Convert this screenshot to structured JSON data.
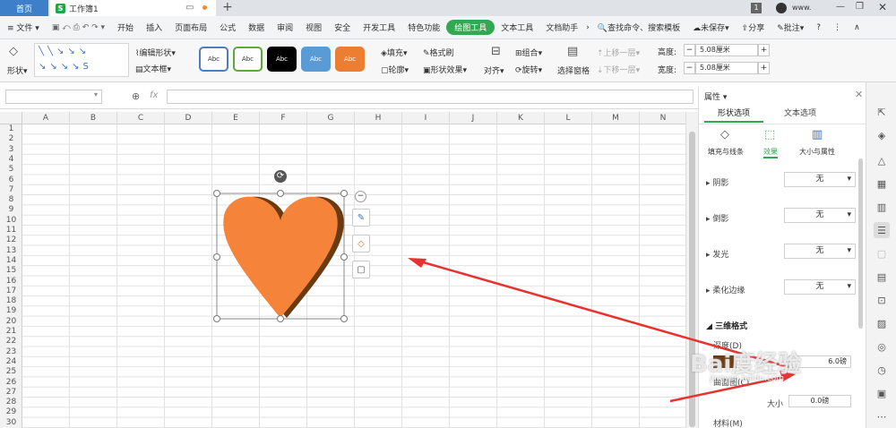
{
  "titlebar": {
    "home_tab": "首页",
    "doc_tab": "工作簿1",
    "page_count": "1",
    "user": "www."
  },
  "menubar": {
    "file": "文件",
    "items": [
      "开始",
      "插入",
      "页面布局",
      "公式",
      "数据",
      "审阅",
      "视图",
      "安全",
      "开发工具",
      "特色功能"
    ],
    "active": "绘图工具",
    "items2": [
      "文本工具",
      "文档助手"
    ],
    "search": "查找命令、搜索模板",
    "unsaved": "未保存",
    "share": "分享",
    "comment": "批注"
  },
  "ribbon": {
    "shape": "形状",
    "edit_shape": "编辑形状",
    "textbox": "文本框",
    "styles": [
      {
        "label": "Abc",
        "bg": "#ffffff",
        "border": "#4a7fc0",
        "fg": "#333"
      },
      {
        "label": "Abc",
        "bg": "#ffffff",
        "border": "#5aaa3a",
        "fg": "#333"
      },
      {
        "label": "Abc",
        "bg": "#000000",
        "border": "#000000",
        "fg": "#fff"
      },
      {
        "label": "Abc",
        "bg": "#5b9bd5",
        "border": "#5b9bd5",
        "fg": "#fff"
      },
      {
        "label": "Abc",
        "bg": "#ed7d31",
        "border": "#ed7d31",
        "fg": "#fff"
      }
    ],
    "fill": "填充",
    "format_brush": "格式刷",
    "outline": "轮廓",
    "shape_effect": "形状效果",
    "align": "对齐",
    "group": "组合",
    "rotate": "旋转",
    "select_pane": "选择窗格",
    "bring_up": "上移一层",
    "send_down": "下移一层",
    "height_label": "高度:",
    "height_value": "5.08厘米",
    "width_label": "宽度:",
    "width_value": "5.08厘米"
  },
  "formula": {
    "fx": "fx"
  },
  "grid": {
    "columns": [
      "A",
      "B",
      "C",
      "D",
      "E",
      "F",
      "G",
      "H",
      "I",
      "J",
      "K",
      "L",
      "M",
      "N"
    ],
    "rows": [
      "1",
      "2",
      "3",
      "4",
      "5",
      "6",
      "7",
      "8",
      "9",
      "10",
      "11",
      "12",
      "13",
      "14",
      "15",
      "16",
      "17",
      "18",
      "19",
      "20",
      "21",
      "22",
      "23",
      "24",
      "25",
      "26",
      "27",
      "28",
      "29",
      "30"
    ]
  },
  "panel": {
    "title": "属性",
    "tab_shape": "形状选项",
    "tab_text": "文本选项",
    "sub_fill": "填充与线条",
    "sub_effect": "效果",
    "sub_size": "大小与属性",
    "rows": [
      {
        "label": "阴影",
        "value": "无"
      },
      {
        "label": "倒影",
        "value": "无"
      },
      {
        "label": "发光",
        "value": "无"
      },
      {
        "label": "柔化边缘",
        "value": "无"
      }
    ],
    "section_3d": "三维格式",
    "depth": "深度(D)",
    "depth_value": "6.0磅",
    "contour": "曲面图(C)",
    "size_label": "大小",
    "size_value": "0.0磅",
    "material": "材料(M)"
  },
  "watermark": {
    "text": "Bai度经验",
    "url": "jingyan.baidu.com"
  },
  "colors": {
    "heart": "#f5843a",
    "heart_shadow": "#6b3a12",
    "accent": "#32a852",
    "arrow": "#e8322f"
  }
}
